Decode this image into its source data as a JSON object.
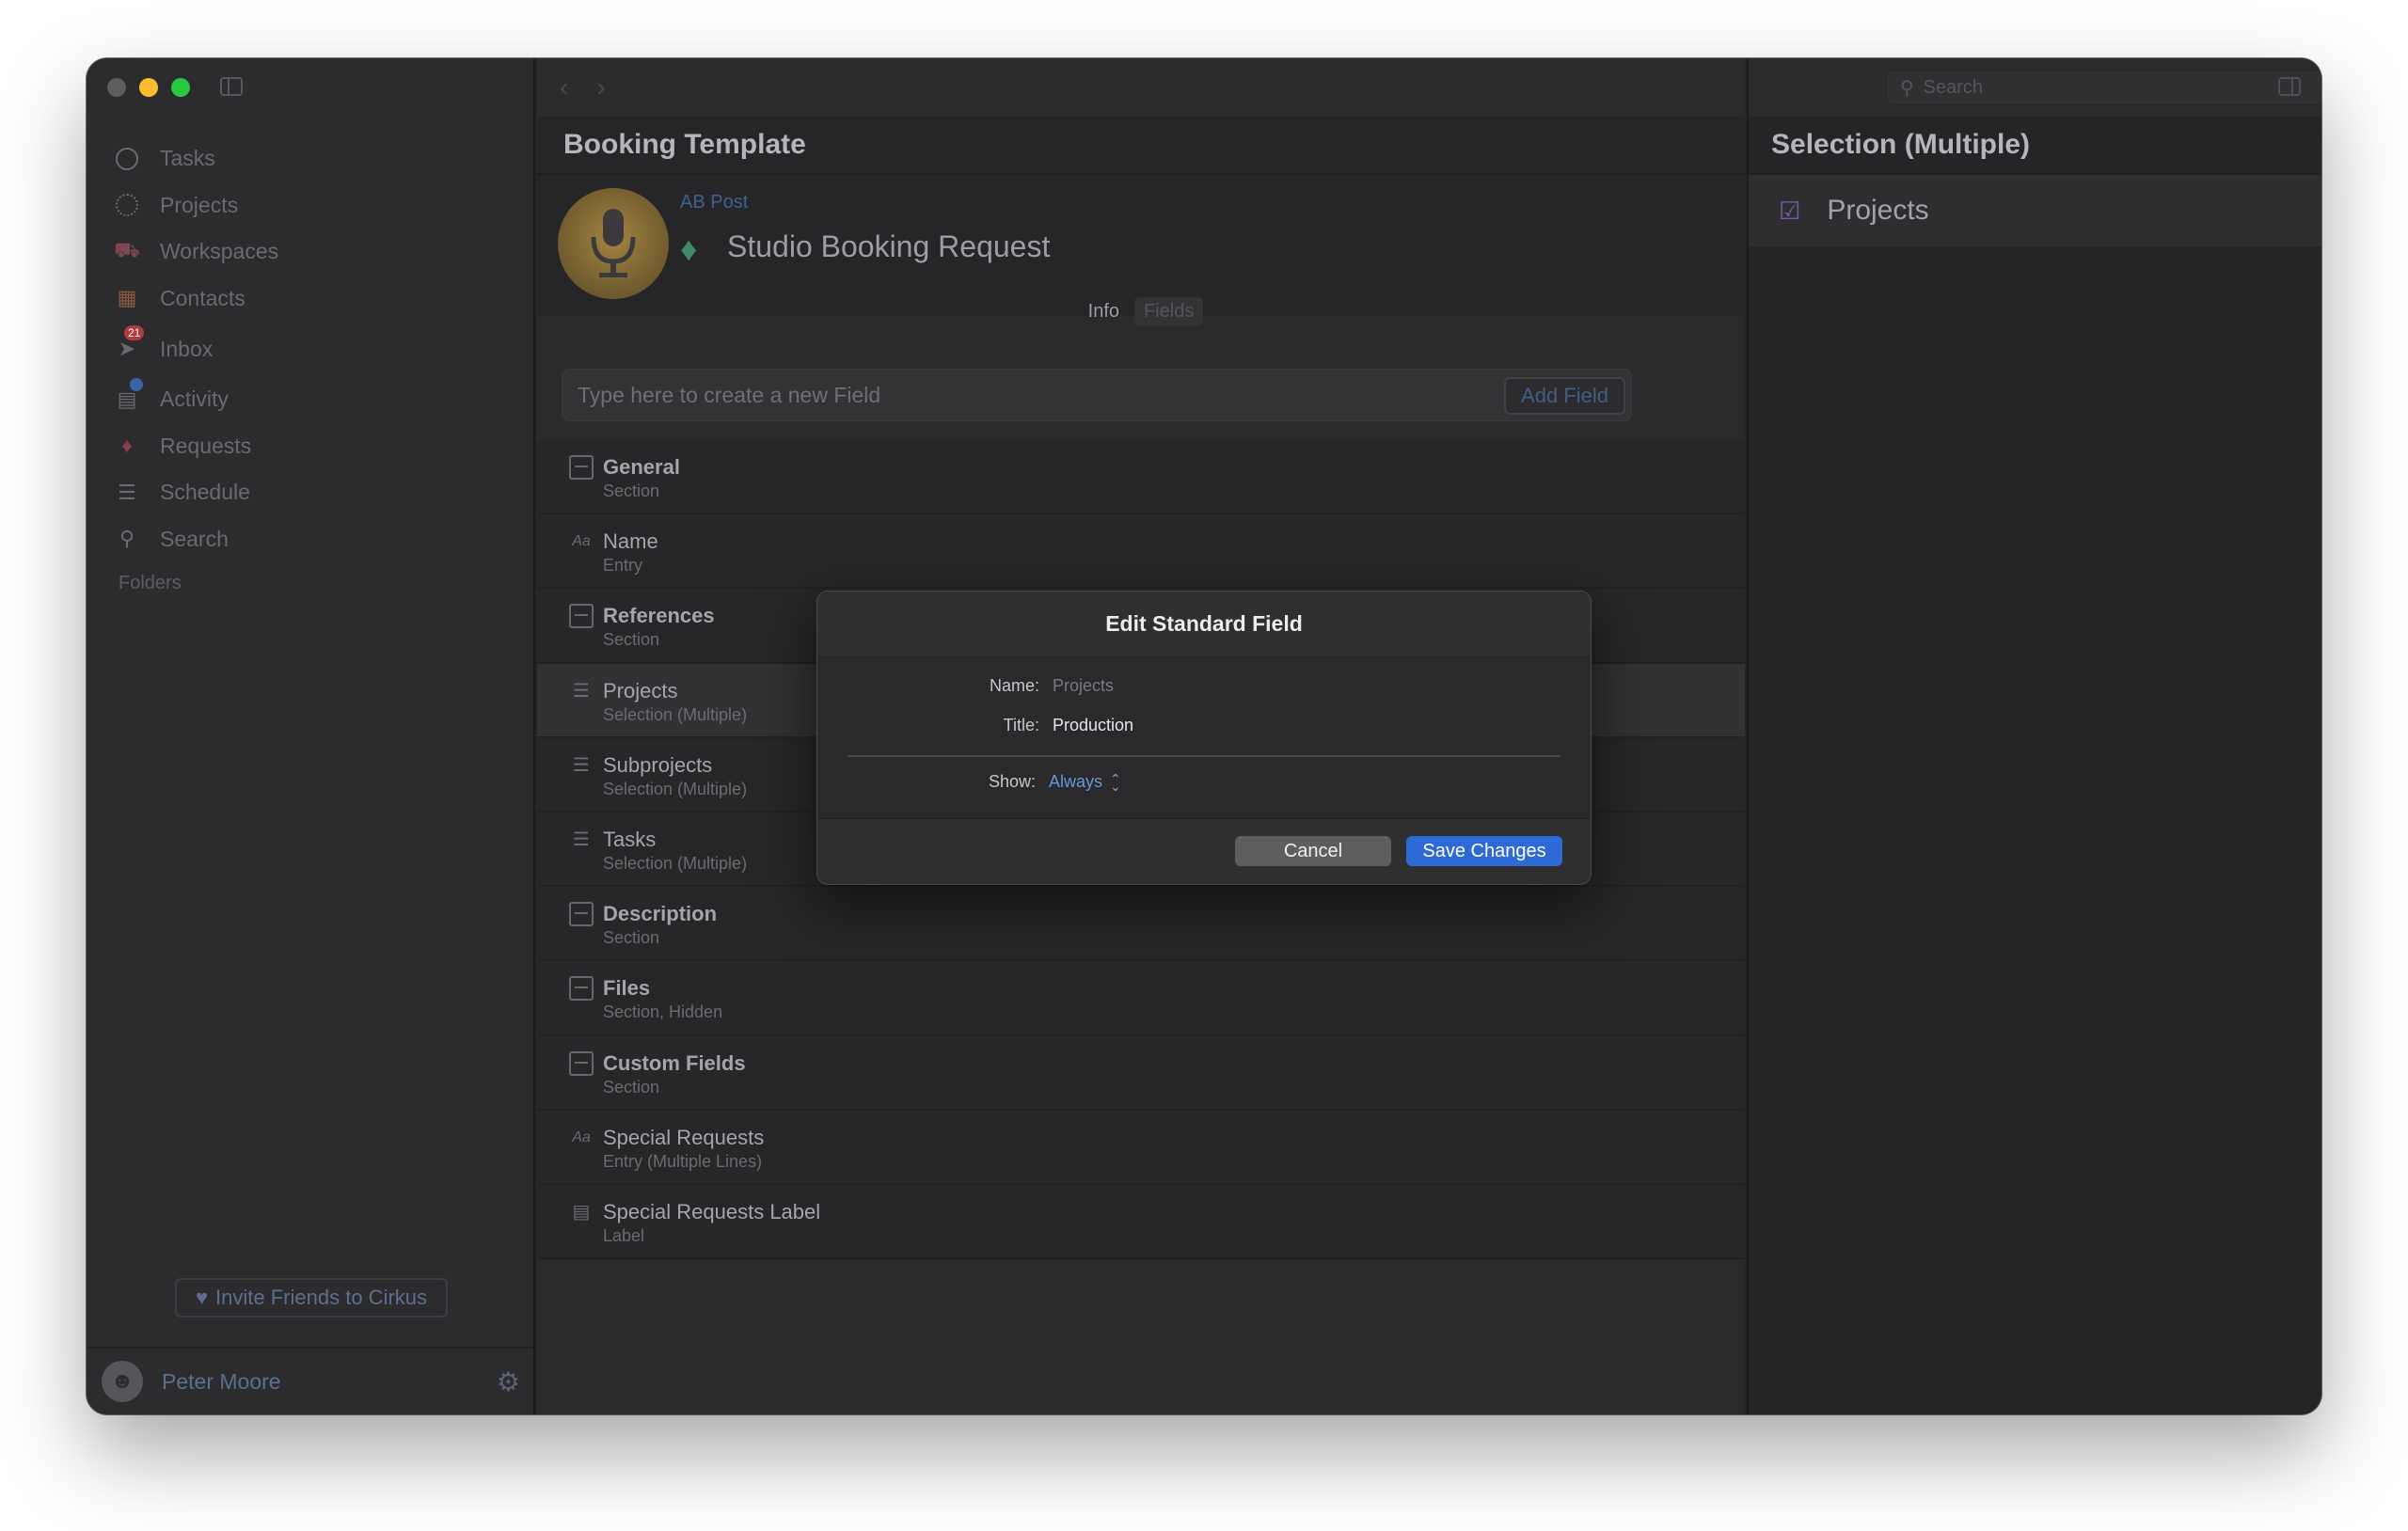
{
  "sidebar": {
    "nav": [
      {
        "label": "Tasks",
        "icon": "circle-icon"
      },
      {
        "label": "Projects",
        "icon": "dotted-circle-icon"
      },
      {
        "label": "Workspaces",
        "icon": "workspaces-icon"
      },
      {
        "label": "Contacts",
        "icon": "contacts-icon"
      },
      {
        "label": "Inbox",
        "icon": "inbox-icon",
        "badge": "21"
      },
      {
        "label": "Activity",
        "icon": "activity-icon"
      },
      {
        "label": "Requests",
        "icon": "requests-icon"
      },
      {
        "label": "Schedule",
        "icon": "schedule-icon"
      },
      {
        "label": "Search",
        "icon": "search-icon"
      }
    ],
    "folders_label": "Folders",
    "invite_label": "Invite Friends to Cirkus",
    "user_name": "Peter Moore"
  },
  "middle": {
    "title": "Booking Template",
    "account_name": "AB Post",
    "request_title": "Studio Booking Request",
    "tabs": [
      {
        "label": "Info"
      },
      {
        "label": "Fields"
      }
    ],
    "new_field_placeholder": "Type here to create a new Field",
    "add_field_label": "Add Field",
    "fields": [
      {
        "name": "General",
        "type": "Section",
        "kind": "section"
      },
      {
        "name": "Name",
        "type": "Entry",
        "kind": "entry"
      },
      {
        "name": "References",
        "type": "Section",
        "kind": "section"
      },
      {
        "name": "Projects",
        "type": "Selection (Multiple)",
        "kind": "selection"
      },
      {
        "name": "Subprojects",
        "type": "Selection (Multiple)",
        "kind": "selection"
      },
      {
        "name": "Tasks",
        "type": "Selection (Multiple)",
        "kind": "selection"
      },
      {
        "name": "Description",
        "type": "Section",
        "kind": "section"
      },
      {
        "name": "Files",
        "type": "Section, Hidden",
        "kind": "section"
      },
      {
        "name": "Custom Fields",
        "type": "Section",
        "kind": "section"
      },
      {
        "name": "Special Requests",
        "type": "Entry (Multiple Lines)",
        "kind": "entry"
      },
      {
        "name": "Special Requests Label",
        "type": "Label",
        "kind": "label"
      }
    ]
  },
  "right": {
    "search_placeholder": "Search",
    "title": "Selection (Multiple)",
    "item_label": "Projects"
  },
  "dialog": {
    "title": "Edit Standard Field",
    "name_label": "Name:",
    "name_value": "Projects",
    "title_label": "Title:",
    "title_value": "Production",
    "show_label": "Show:",
    "show_value": "Always",
    "cancel_label": "Cancel",
    "save_label": "Save Changes"
  },
  "colors": {
    "accent": "#2e6ad5",
    "window_bg": "#252528",
    "sidebar_bg": "#2c2c2f"
  }
}
